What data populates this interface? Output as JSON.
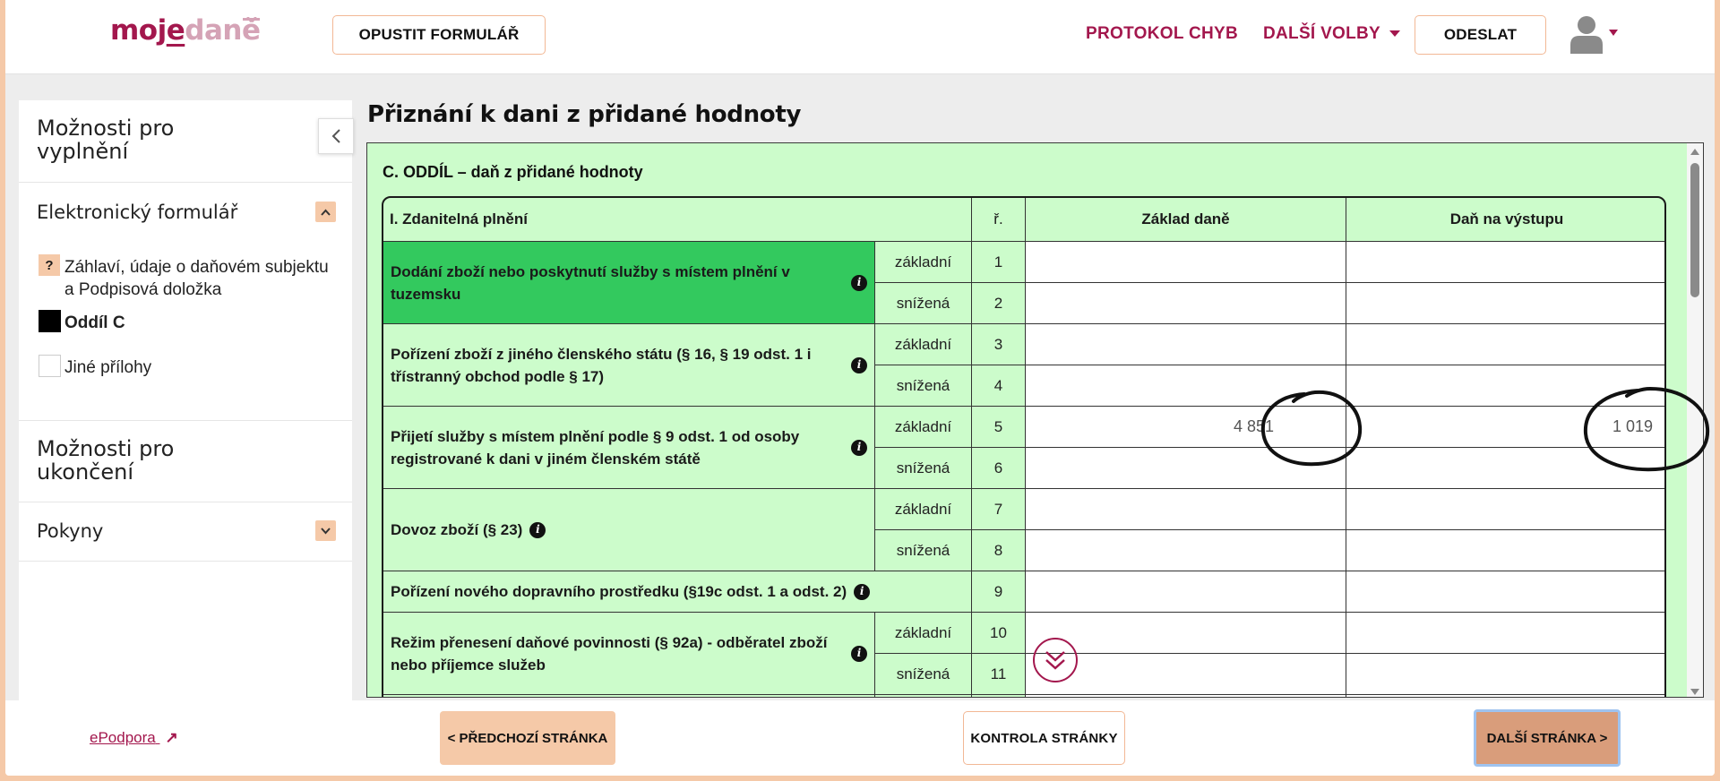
{
  "header": {
    "logo": {
      "part1": "moj",
      "part2": "e",
      "part3": "daně"
    },
    "leave_form": "OPUSTIT FORMULÁŘ",
    "error_log": "PROTOKOL CHYB",
    "more_options": "DALŠÍ VOLBY",
    "send": "ODESLAT",
    "user_icon": "user-icon"
  },
  "sidebar": {
    "fill_options_title": "Možnosti pro vyplnění",
    "electronic_form": "Elektronický formulář",
    "items": [
      {
        "label": "Záhlaví, údaje o daňovém subjektu a Podpisová doložka",
        "marker": "?",
        "state": "warning"
      },
      {
        "label": "Oddíl C",
        "state": "active"
      },
      {
        "label": "Jiné přílohy",
        "state": "empty"
      }
    ],
    "finish_options_title": "Možnosti pro ukončení",
    "instructions": "Pokyny"
  },
  "main": {
    "page_title": "Přiznání k dani z přidané hodnoty",
    "section_title": "C. ODDÍL – daň z přidané hodnoty",
    "table": {
      "headers": {
        "group": "I. Zdanitelná plnění",
        "row": "ř.",
        "base": "Základ daně",
        "tax": "Daň na výstupu"
      },
      "groups": [
        {
          "label": "Dodání zboží nebo poskytnutí služby s místem plnění v tuzemsku",
          "highlight": true,
          "rows": [
            {
              "type": "základní",
              "no": "1",
              "base": "",
              "tax": ""
            },
            {
              "type": "snížená",
              "no": "2",
              "base": "",
              "tax": ""
            }
          ]
        },
        {
          "label": "Pořízení zboží z jiného členského státu (§ 16, § 19 odst. 1 i třístranný obchod podle § 17)",
          "rows": [
            {
              "type": "základní",
              "no": "3",
              "base": "",
              "tax": ""
            },
            {
              "type": "snížená",
              "no": "4",
              "base": "",
              "tax": ""
            }
          ]
        },
        {
          "label": "Přijetí služby s místem plnění podle § 9 odst. 1 od osoby registrované k dani v jiném členském státě",
          "rows": [
            {
              "type": "základní",
              "no": "5",
              "base": "4 851",
              "tax": "1 019"
            },
            {
              "type": "snížená",
              "no": "6",
              "base": "",
              "tax": ""
            }
          ]
        },
        {
          "label": "Dovoz zboží (§ 23)",
          "rows": [
            {
              "type": "základní",
              "no": "7",
              "base": "",
              "tax": ""
            },
            {
              "type": "snížená",
              "no": "8",
              "base": "",
              "tax": ""
            }
          ]
        },
        {
          "label": "Pořízení nového dopravního prostředku (§19c odst. 1 a odst. 2)",
          "rows": [
            {
              "type": "",
              "no": "9",
              "base": "",
              "tax": ""
            }
          ]
        },
        {
          "label": "Režim přenesení daňové povinnosti (§ 92a) - odběratel zboží nebo příjemce služeb",
          "rows": [
            {
              "type": "základní",
              "no": "10",
              "base": "",
              "tax": ""
            },
            {
              "type": "snížená",
              "no": "11",
              "base": "",
              "tax": ""
            }
          ]
        }
      ]
    }
  },
  "footer": {
    "support": "ePodpora",
    "prev": "< PŘEDCHOZÍ STRÁNKA",
    "check": "KONTROLA STRÁNKY",
    "next": "DALŠÍ STRÁNKA >"
  },
  "colors": {
    "brand": "#a3174d",
    "accent": "#f5c9a8",
    "row_highlight": "#33c95e",
    "panel": "#ccfccb"
  }
}
